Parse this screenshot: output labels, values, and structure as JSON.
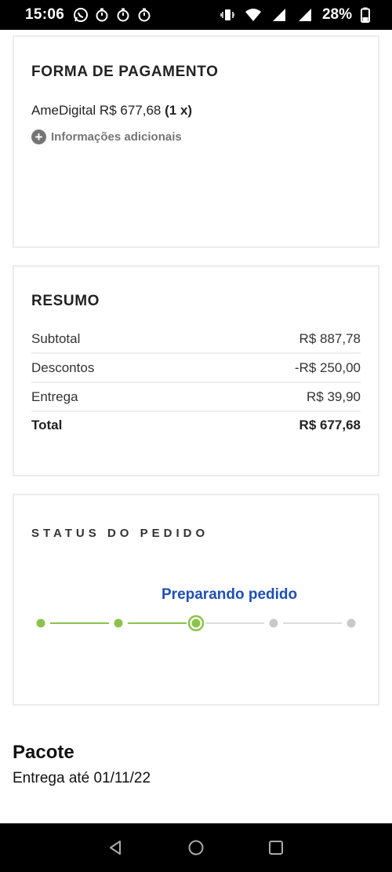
{
  "status_bar": {
    "time": "15:06",
    "battery": "28%",
    "icons": [
      "whatsapp-icon",
      "timer-icon",
      "timer-icon",
      "timer-icon",
      "vibrate-icon",
      "wifi-icon",
      "signal-icon",
      "signal-icon",
      "battery-icon"
    ]
  },
  "payment": {
    "title": "FORMA DE PAGAMENTO",
    "method": "AmeDigital R$ 677,68",
    "installments": "(1 x)",
    "more_info": "Informações adicionais"
  },
  "summary": {
    "title": "RESUMO",
    "rows": [
      {
        "label": "Subtotal",
        "value": "R$ 887,78"
      },
      {
        "label": "Descontos",
        "value": "-R$ 250,00"
      },
      {
        "label": "Entrega",
        "value": "R$ 39,90"
      },
      {
        "label": "Total",
        "value": "R$ 677,68"
      }
    ]
  },
  "order_status": {
    "title": "STATUS DO PEDIDO",
    "current_stage": "Preparando pedido",
    "steps_total": 5,
    "current_step": 3,
    "colors": {
      "done": "#8bc34a",
      "pending": "#c8c8c8",
      "label": "#1e4fb6"
    }
  },
  "package": {
    "title": "Pacote",
    "delivery": "Entrega até 01/11/22"
  },
  "nav": [
    "back-icon",
    "home-icon",
    "recents-icon"
  ]
}
